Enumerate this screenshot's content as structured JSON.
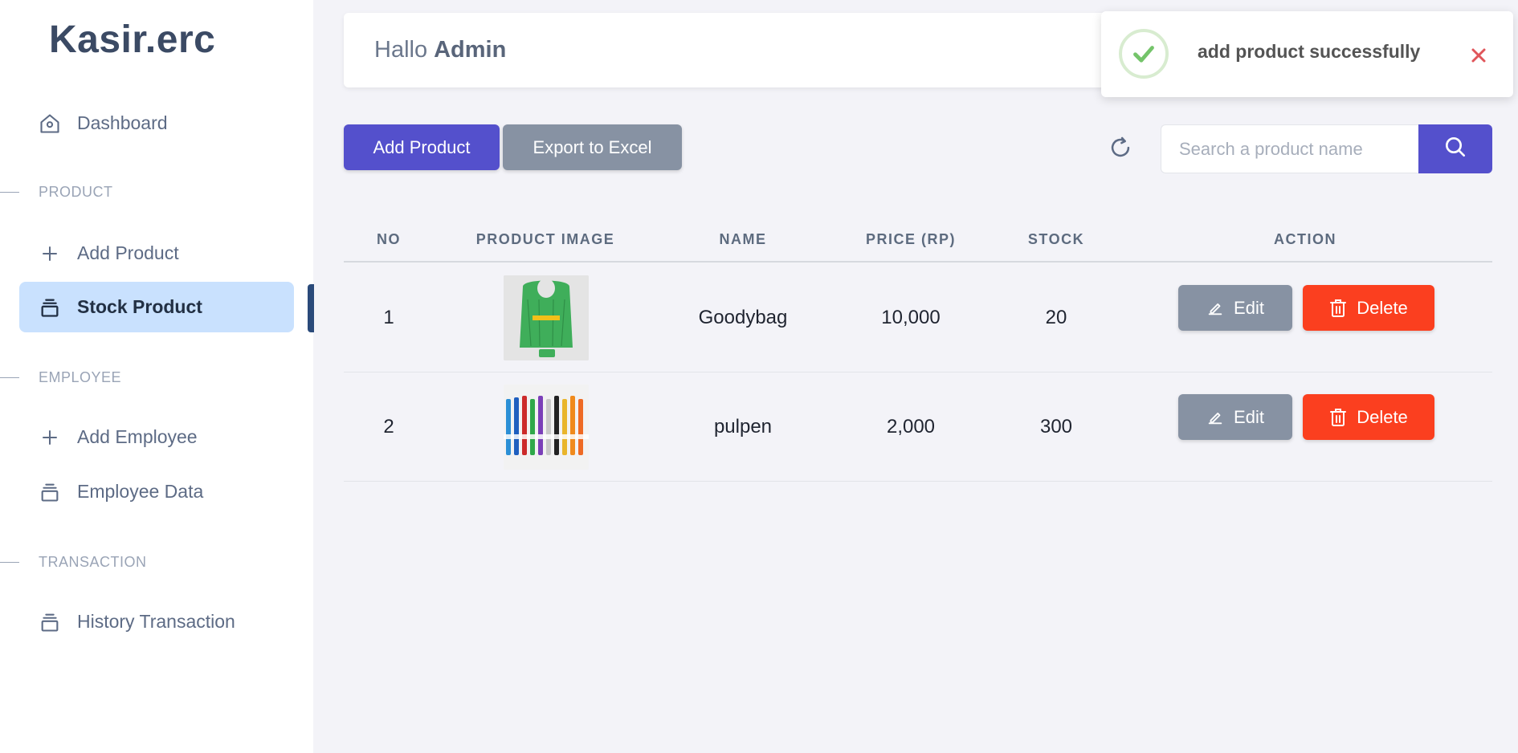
{
  "app": {
    "brand": "Kasir.erc"
  },
  "sidebar": {
    "dashboard": "Dashboard",
    "sections": {
      "product": "PRODUCT",
      "employee": "EMPLOYEE",
      "transaction": "TRANSACTION"
    },
    "items": {
      "add_product": "Add Product",
      "stock_product": "Stock Product",
      "add_employee": "Add Employee",
      "employee_data": "Employee Data",
      "history_transaction": "History Transaction"
    },
    "active_item": "Stock Product"
  },
  "header": {
    "greeting": "Hallo",
    "user": "Admin"
  },
  "toolbar": {
    "add_product": "Add Product",
    "export_excel": "Export to Excel",
    "search_placeholder": "Search a product name"
  },
  "table": {
    "columns": [
      "NO",
      "PRODUCT IMAGE",
      "NAME",
      "PRICE (RP)",
      "STOCK",
      "ACTION"
    ],
    "rows": [
      {
        "no": "1",
        "image_icon": "green-tote-bag-photo",
        "name": "Goodybag",
        "price": "10,000",
        "stock": "20"
      },
      {
        "no": "2",
        "image_icon": "colored-pens-photo",
        "name": "pulpen",
        "price": "2,000",
        "stock": "300"
      }
    ],
    "actions": {
      "edit": "Edit",
      "delete": "Delete"
    }
  },
  "toast": {
    "message": "add product successfully",
    "status": "success"
  },
  "colors": {
    "primary": "#5450cc",
    "danger": "#fb3f1f",
    "neutral": "#8792a3",
    "active_bg": "#c9e1fe",
    "success": "#74c46a"
  }
}
